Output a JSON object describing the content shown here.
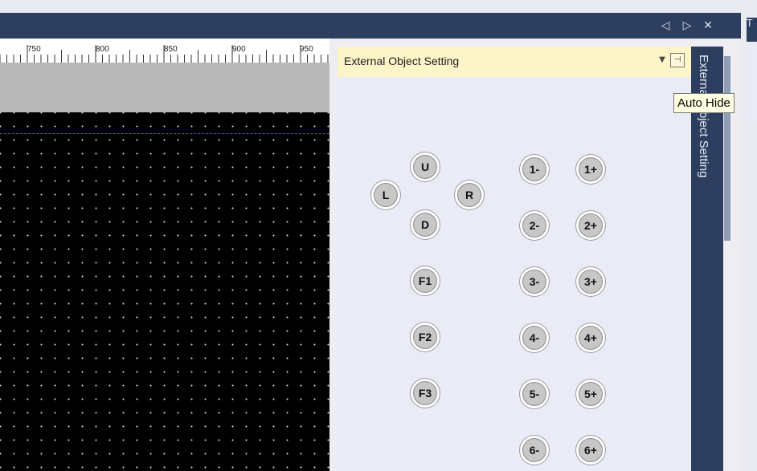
{
  "window": {
    "title_bar_controls": [
      {
        "name": "scroll-left-icon",
        "glyph": "◁"
      },
      {
        "name": "scroll-right-icon",
        "glyph": "▷"
      },
      {
        "name": "close-icon",
        "glyph": "✕"
      }
    ],
    "right_edge_tab_label": "T"
  },
  "ruler": {
    "labels": [
      "750",
      "800",
      "850",
      "900",
      "950"
    ]
  },
  "panel": {
    "title": "External Object Setting",
    "dropdown_glyph": "▼",
    "pin_glyph": "⊣",
    "vertical_tab_label": "External Object Setting",
    "tooltip": "Auto Hide",
    "direction_buttons": [
      "U",
      "L",
      "R",
      "D"
    ],
    "function_buttons": [
      "F1",
      "F2",
      "F3"
    ],
    "numeric_buttons": [
      [
        "1-",
        "1+"
      ],
      [
        "2-",
        "2+"
      ],
      [
        "3-",
        "3+"
      ],
      [
        "4-",
        "4+"
      ],
      [
        "5-",
        "5+"
      ],
      [
        "6-",
        "6+"
      ]
    ]
  },
  "colors": {
    "title_bar": "#2d3e5f",
    "panel_header": "#fdf4c7",
    "panel_bg": "#e9ebf7",
    "canvas_bg": "#000000",
    "guide_line": "#3a5bd9",
    "tooltip_bg": "#ffffe1"
  }
}
